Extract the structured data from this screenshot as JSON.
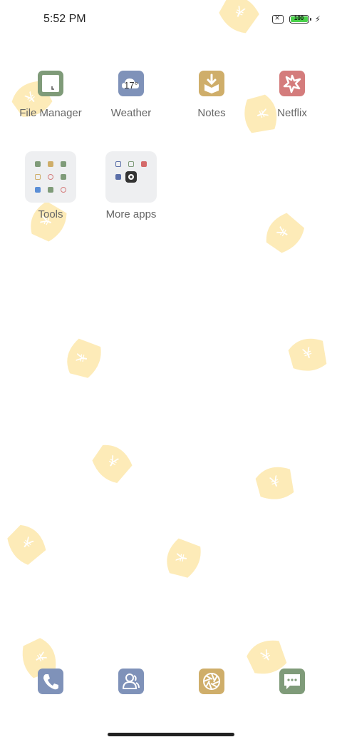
{
  "status_bar": {
    "time": "5:52 PM",
    "battery_level": "100",
    "battery_percent": 100
  },
  "apps": [
    {
      "label": "File Manager",
      "icon": "folder-file-icon",
      "color": "#7f9b79"
    },
    {
      "label": "Weather",
      "icon": "cloud-sun-icon",
      "color": "#7f92b9",
      "icon_text": "17°"
    },
    {
      "label": "Notes",
      "icon": "notes-download-icon",
      "color": "#cfae6a"
    },
    {
      "label": "Netflix",
      "icon": "netflix-star-icon",
      "color": "#d47c7c"
    }
  ],
  "folders": [
    {
      "label": "Tools"
    },
    {
      "label": "More apps"
    }
  ],
  "dock": [
    {
      "icon": "phone-icon",
      "color": "#7f92b9"
    },
    {
      "icon": "contacts-icon",
      "color": "#7f92b9"
    },
    {
      "icon": "camera-aperture-icon",
      "color": "#cfae6a"
    },
    {
      "icon": "messages-icon",
      "color": "#7f9b79"
    }
  ]
}
